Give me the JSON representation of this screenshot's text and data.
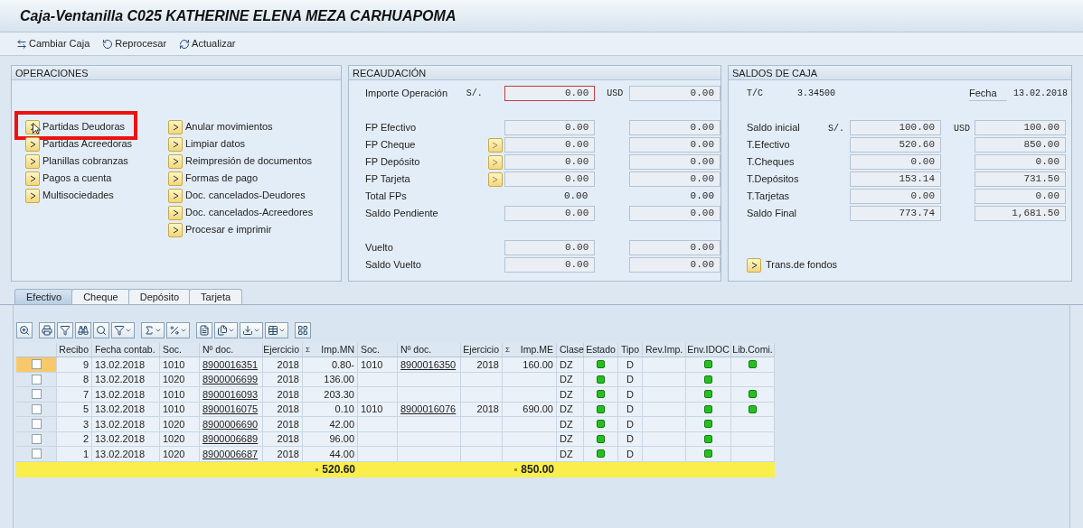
{
  "window": {
    "title": "Caja-Ventanilla C025 KATHERINE ELENA MEZA CARHUAPOMA"
  },
  "toolbar": [
    {
      "label": "Cambiar Caja",
      "kind": "switch"
    },
    {
      "label": "Reprocesar",
      "kind": "reprocess"
    },
    {
      "label": "Actualizar",
      "kind": "refresh"
    }
  ],
  "operaciones": {
    "title": "OPERACIONES",
    "columns": [
      [
        {
          "label": "Partidas Deudoras",
          "highlighted": true
        },
        {
          "label": "Partidas Acreedoras",
          "highlighted": false
        },
        {
          "label": "Planillas cobranzas",
          "highlighted": false
        },
        {
          "label": "Pagos a cuenta",
          "highlighted": false
        },
        {
          "label": "Multisociedades",
          "highlighted": false
        }
      ],
      [
        {
          "label": "Anular movimientos",
          "highlighted": false
        },
        {
          "label": "Limpiar datos",
          "highlighted": false
        },
        {
          "label": "Reimpresión de documentos",
          "highlighted": false
        },
        {
          "label": "Formas de pago",
          "highlighted": false
        },
        {
          "label": "Doc. cancelados-Deudores",
          "highlighted": false
        },
        {
          "label": "Doc. cancelados-Acreedores",
          "highlighted": false
        },
        {
          "label": "Procesar e imprimir",
          "highlighted": false
        }
      ]
    ]
  },
  "recaudacion": {
    "title": "RECAUDACIÓN",
    "rows": [
      {
        "label": "Importe Operación",
        "kind": "field",
        "cur1": "S/.",
        "cur2": "USD",
        "button": false,
        "focused": true,
        "v1": "0.00",
        "v2": "0.00"
      },
      {
        "label": "FP Efectivo",
        "kind": "field",
        "button": false,
        "focused": false,
        "v1": "0.00",
        "v2": "0.00"
      },
      {
        "label": "FP Cheque",
        "kind": "field",
        "button": true,
        "focused": false,
        "v1": "0.00",
        "v2": "0.00"
      },
      {
        "label": "FP Depósito",
        "kind": "field",
        "button": true,
        "focused": false,
        "v1": "0.00",
        "v2": "0.00"
      },
      {
        "label": "FP Tarjeta",
        "kind": "field",
        "button": true,
        "focused": false,
        "v1": "0.00",
        "v2": "0.00"
      },
      {
        "label": "Total FPs",
        "kind": "text",
        "button": false,
        "focused": false,
        "v1": "0.00",
        "v2": "0.00"
      },
      {
        "label": "Saldo Pendiente",
        "kind": "field",
        "button": false,
        "focused": false,
        "v1": "0.00",
        "v2": "0.00"
      },
      {
        "label": "Vuelto",
        "kind": "field",
        "button": false,
        "focused": false,
        "v1": "0.00",
        "v2": "0.00"
      },
      {
        "label": "Saldo Vuelto",
        "kind": "field",
        "button": false,
        "focused": false,
        "v1": "0.00",
        "v2": "0.00"
      }
    ]
  },
  "saldos": {
    "title": "SALDOS DE CAJA",
    "tc_label": "T/C",
    "tc_value": "3.34500",
    "fecha_label": "Fecha",
    "fecha_value": "13.02.2018",
    "rows": [
      {
        "label": "Saldo inicial",
        "cur1": "S/.",
        "cur2": "USD",
        "v1": "100.00",
        "v2": "100.00"
      },
      {
        "label": "T.Efectivo",
        "v1": "520.60",
        "v2": "850.00"
      },
      {
        "label": "T.Cheques",
        "v1": "0.00",
        "v2": "0.00"
      },
      {
        "label": "T.Depósitos",
        "v1": "153.14",
        "v2": "731.50"
      },
      {
        "label": "T.Tarjetas",
        "v1": "0.00",
        "v2": "0.00"
      },
      {
        "label": "Saldo Final",
        "v1": "773.74",
        "v2": "1,681.50"
      }
    ],
    "transfer_button": "Trans.de fondos"
  },
  "tabs": [
    {
      "label": "Efectivo",
      "selected": true
    },
    {
      "label": "Cheque",
      "selected": false
    },
    {
      "label": "Depósito",
      "selected": false
    },
    {
      "label": "Tarjeta",
      "selected": false
    }
  ],
  "table": {
    "columns": [
      {
        "kind": "check"
      },
      {
        "label": "Recibo",
        "kind": "num"
      },
      {
        "label": "Fecha contab.",
        "kind": "text"
      },
      {
        "label": "Soc.",
        "kind": "text"
      },
      {
        "label": "Nº doc.",
        "kind": "link"
      },
      {
        "label": "Ejercicio",
        "kind": "num"
      },
      {
        "label": "Imp.MN",
        "kind": "num",
        "sum_mark": "Σ",
        "total": "520.60"
      },
      {
        "label": "Soc.",
        "kind": "text"
      },
      {
        "label": "Nº doc.",
        "kind": "link"
      },
      {
        "label": "Ejercicio",
        "kind": "num"
      },
      {
        "label": "Imp.ME",
        "kind": "num",
        "sum_mark": "Σ",
        "total": "850.00"
      },
      {
        "label": "Clase",
        "kind": "text"
      },
      {
        "label": "Estado",
        "kind": "light"
      },
      {
        "label": "Tipo",
        "kind": "center"
      },
      {
        "label": "Rev.Imp.",
        "kind": "text"
      },
      {
        "label": "Env.IDOC",
        "kind": "light"
      },
      {
        "label": "Lib.Comi.",
        "kind": "light"
      }
    ],
    "rows": [
      {
        "selected": true,
        "checked": false,
        "recibo": "9",
        "fecha": "13.02.2018",
        "soc": "1010",
        "doc": "8900016351",
        "ejercicio": "2018",
        "imp_mn": "0.80-",
        "soc_2": "1010",
        "doc_2": "8900016350",
        "ejercicio_2": "2018",
        "imp_me": "160.00",
        "clase": "DZ",
        "estado": true,
        "tipo": "D",
        "env_idoc": true,
        "lib_comi": true
      },
      {
        "selected": false,
        "checked": false,
        "recibo": "8",
        "fecha": "13.02.2018",
        "soc": "1020",
        "doc": "8900006699",
        "ejercicio": "2018",
        "imp_mn": "136.00",
        "clase": "DZ",
        "estado": true,
        "tipo": "D",
        "env_idoc": true,
        "lib_comi": false
      },
      {
        "selected": false,
        "checked": false,
        "recibo": "7",
        "fecha": "13.02.2018",
        "soc": "1010",
        "doc": "8900016093",
        "ejercicio": "2018",
        "imp_mn": "203.30",
        "clase": "DZ",
        "estado": true,
        "tipo": "D",
        "env_idoc": true,
        "lib_comi": true
      },
      {
        "selected": false,
        "checked": false,
        "recibo": "5",
        "fecha": "13.02.2018",
        "soc": "1010",
        "doc": "8900016075",
        "ejercicio": "2018",
        "imp_mn": "0.10",
        "soc_2": "1010",
        "doc_2": "8900016076",
        "ejercicio_2": "2018",
        "imp_me": "690.00",
        "clase": "DZ",
        "estado": true,
        "tipo": "D",
        "env_idoc": true,
        "lib_comi": true
      },
      {
        "selected": false,
        "checked": false,
        "recibo": "3",
        "fecha": "13.02.2018",
        "soc": "1020",
        "doc": "8900006690",
        "ejercicio": "2018",
        "imp_mn": "42.00",
        "clase": "DZ",
        "estado": true,
        "tipo": "D",
        "env_idoc": true,
        "lib_comi": false
      },
      {
        "selected": false,
        "checked": false,
        "recibo": "2",
        "fecha": "13.02.2018",
        "soc": "1020",
        "doc": "8900006689",
        "ejercicio": "2018",
        "imp_mn": "96.00",
        "clase": "DZ",
        "estado": true,
        "tipo": "D",
        "env_idoc": true,
        "lib_comi": false
      },
      {
        "selected": false,
        "checked": false,
        "recibo": "1",
        "fecha": "13.02.2018",
        "soc": "1020",
        "doc": "8900006687",
        "ejercicio": "2018",
        "imp_mn": "44.00",
        "clase": "DZ",
        "estado": true,
        "tipo": "D",
        "env_idoc": true,
        "lib_comi": false
      }
    ]
  }
}
